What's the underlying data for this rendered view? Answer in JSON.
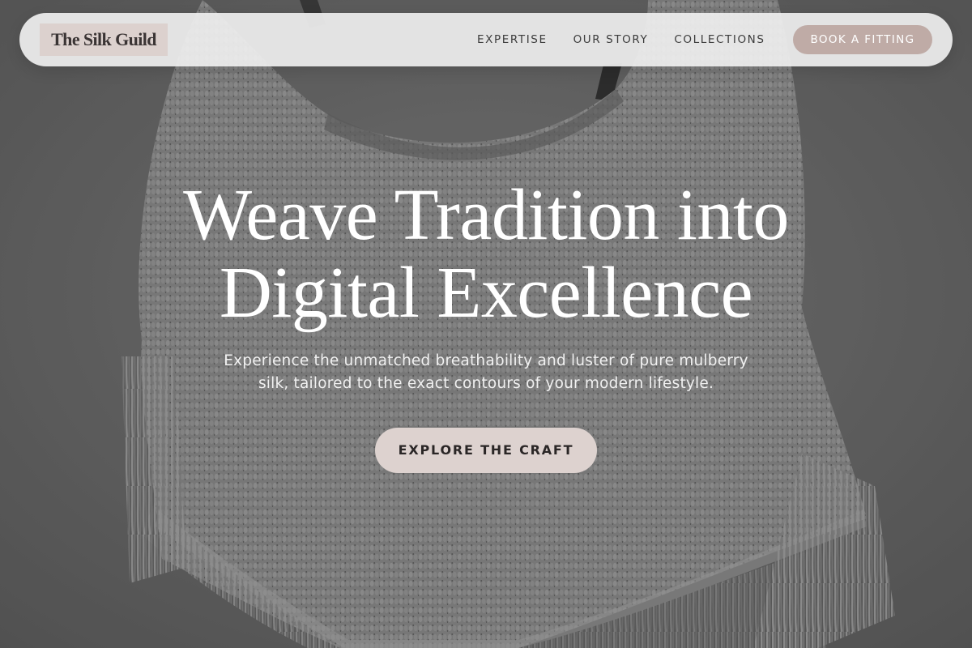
{
  "brand": {
    "name": "The Silk Guild"
  },
  "nav": {
    "links": [
      "EXPERTISE",
      "OUR STORY",
      "COLLECTIONS"
    ],
    "cta_label": "BOOK A FITTING"
  },
  "hero": {
    "headline_line1": "Weave Tradition into",
    "headline_line2": "Digital Excellence",
    "subtext_line1": "Experience the unmatched breathability and luster of pure mulberry",
    "subtext_line2": "silk, tailored to the exact contours of your modern lifestyle.",
    "cta_label": "EXPLORE THE CRAFT",
    "background_image": "knitted-fringe-garment-photo"
  },
  "colors": {
    "logo_bg": "#dcd1ce",
    "nav_cta_bg": "#bfaba6",
    "hero_cta_bg": "#ddd2cf",
    "nav_bg": "#eeeeee"
  }
}
